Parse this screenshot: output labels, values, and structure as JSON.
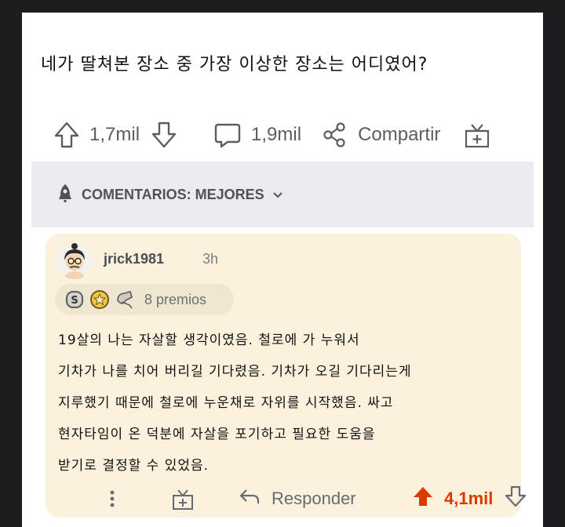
{
  "post": {
    "title": "네가 딸쳐본 장소 중 가장 이상한 장소는 어디였어?",
    "upvotes": "1,7mil",
    "comments": "1,9mil",
    "share_label": "Compartir"
  },
  "sort": {
    "label": "COMENTARIOS: MEJORES"
  },
  "comment": {
    "username": "jrick1981",
    "time": "3h",
    "awards_label": "8 premios",
    "body_lines": [
      "19살의 나는 자살할 생각이였음. 철로에 가 누워서",
      "기차가 나를 치어 버리길 기다렸음. 기차가 오길 기다리는게",
      "지루했기 때문에 철로에 누운채로 자위를 시작했음. 싸고",
      "현자타임이 온 덕분에 자살을 포기하고 필요한 도움을",
      "받기로 결정할 수 있었음."
    ],
    "reply_label": "Responder",
    "score": "4,1mil"
  },
  "colors": {
    "accent": "#d93a00",
    "comment_bg": "#fbf1dc",
    "sort_bar_bg": "#e8ecf0"
  }
}
